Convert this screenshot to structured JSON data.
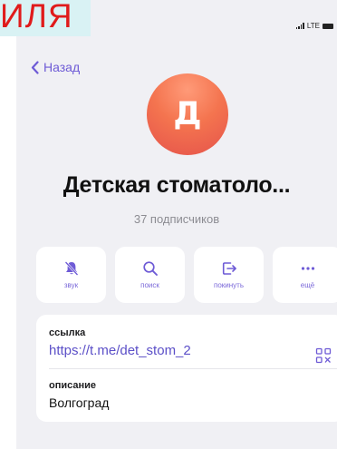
{
  "overlay": {
    "text": "ИЛЯ",
    "text_color": "#e01b1b",
    "background": "#d9f2f4"
  },
  "status_bar": {
    "network": "LTE",
    "icons": [
      "signal-icon",
      "battery-icon"
    ]
  },
  "navigation": {
    "back_label": "Назад",
    "back_icon": "chevron-left-icon"
  },
  "channel": {
    "avatar_letter": "Д",
    "avatar_colors": [
      "#ff9a78",
      "#e5534b"
    ],
    "title": "Детская стоматоло...",
    "subscribers": "37 подписчиков"
  },
  "actions": [
    {
      "label": "звук",
      "icon": "bell-icon"
    },
    {
      "label": "поиск",
      "icon": "search-icon"
    },
    {
      "label": "покинуть",
      "icon": "leave-icon"
    },
    {
      "label": "ещё",
      "icon": "more-icon"
    }
  ],
  "info": {
    "link_label": "ссылка",
    "link_value": "https://t.me/det_stom_2",
    "qr_icon": "qr-code-icon",
    "description_label": "описание",
    "description_value": "Волгоград"
  },
  "colors": {
    "accent": "#6e5bd6",
    "background": "#f0f0f4",
    "card": "#ffffff"
  }
}
